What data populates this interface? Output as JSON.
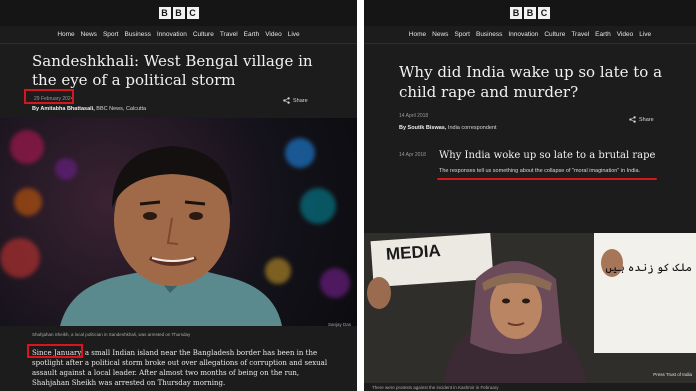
{
  "left": {
    "brand": [
      "B",
      "B",
      "C"
    ],
    "nav": [
      "Home",
      "News",
      "Sport",
      "Business",
      "Innovation",
      "Culture",
      "Travel",
      "Earth",
      "Video",
      "Live"
    ],
    "headline": "Sandeshkhali: West Bengal village in the eye of a political storm",
    "date": "29 February 2024",
    "byline_name": "By Amitabha Bhattasali,",
    "byline_org": " BBC News, Calcutta",
    "share_label": "Share",
    "photo_caption": "Shahjahan Sheikh, a local politician in Sandeshkhali, was arrested on Thursday",
    "photo_credit": "Sanjay Das",
    "body_highlight": "Since January",
    "body_lines": [
      ", a small Indian island near the Bangladesh border has been in the",
      "spotlight after a political storm broke out over allegations of corruption and sexual",
      "assault against a local leader. After almost two months of being on the run,",
      "Shahjahan Sheikh was arrested on Thursday morning."
    ]
  },
  "right": {
    "brand": [
      "B",
      "B",
      "C"
    ],
    "nav": [
      "Home",
      "News",
      "Sport",
      "Business",
      "Innovation",
      "Culture",
      "Travel",
      "Earth",
      "Video",
      "Live"
    ],
    "headline": "Why did India wake up so late to a child rape and murder?",
    "date": "14 April 2018",
    "byline_name": "By Soutik Biswas,",
    "byline_org": " India correspondent",
    "share_label": "Share",
    "inner_date": "14 Apr 2018",
    "sub_headline": "Why India woke up so late to a brutal rape",
    "sub_desc": "The responses tell us something about the collapse of \"moral imagination\" in India.",
    "photo_sign_left": "MEDIA",
    "photo_sign_right": "ملک کو زندہ ہیں",
    "photo_credit": "Press Trust of India",
    "photo_caption": "There were protests against the incident in Kashmir in February"
  },
  "colors": {
    "background": "#1c1c1c",
    "highlight_red": "#d9141a",
    "text": "#f1f1f1"
  }
}
